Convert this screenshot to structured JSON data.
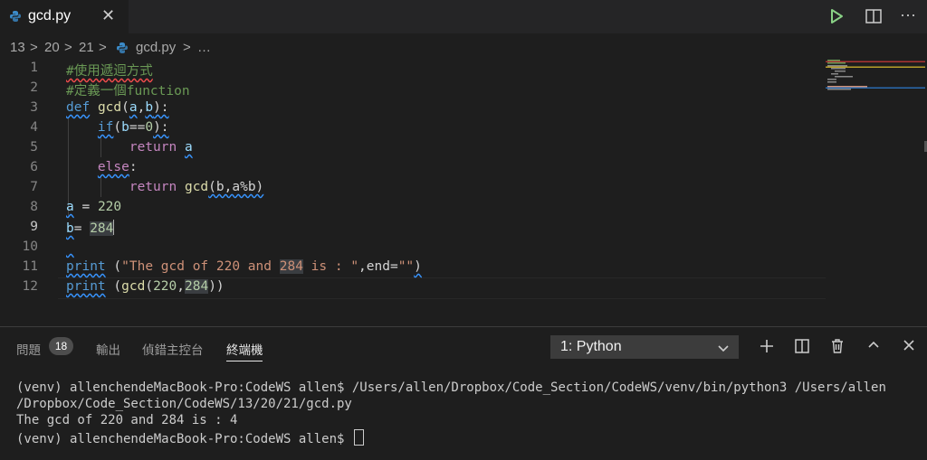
{
  "tab": {
    "filename": "gcd.py"
  },
  "breadcrumb": {
    "p1": "13",
    "p2": "20",
    "p3": "21",
    "file": "gcd.py",
    "more": "…",
    "sep": ">"
  },
  "editor": {
    "line_numbers": [
      "1",
      "2",
      "3",
      "4",
      "5",
      "6",
      "7",
      "8",
      "9",
      "10",
      "11",
      "12"
    ],
    "lines": {
      "l1": "#使用遞迴方式",
      "l2": "#定義一個function",
      "l3_kw": "def",
      "l3_fn": "gcd",
      "l3_rest1": "(",
      "l3_a": "a",
      "l3_comma": ",",
      "l3_b": "b",
      "l3_rest2": "):",
      "l4_kw": "if",
      "l4_p": "(",
      "l4_b": "b",
      "l4_eq": "==",
      "l4_num": "0",
      "l4_end": "):",
      "l5_kw": "return",
      "l5_a": "a",
      "l6_kw": "else",
      "l6_colon": ":",
      "l7_kw": "return",
      "l7_fn": "gcd",
      "l7_rest": "(b,a%b)",
      "l8_a": "a",
      "l8_eq": " = ",
      "l8_num": "220",
      "l9_b": "b",
      "l9_eq": "= ",
      "l9_num": "284",
      "l11_fn": "print",
      "l11_p": " (",
      "l11_str": "\"The gcd of 220 and ",
      "l11_hl": "284",
      "l11_str2": " is : \"",
      "l11_end": ",end=",
      "l11_str3": "\"\"",
      "l11_close": ")",
      "l12_fn": "print",
      "l12_p": " (",
      "l12_fn2": "gcd",
      "l12_args1": "(",
      "l12_n1": "220",
      "l12_c": ",",
      "l12_n2": "284",
      "l12_close": "))"
    }
  },
  "panel": {
    "tabs": {
      "problems": "問題",
      "problems_count": "18",
      "output": "輸出",
      "debug": "偵錯主控台",
      "terminal": "終端機"
    },
    "terminal_select": "1: Python",
    "terminal_lines": [
      "(venv) allenchendeMacBook-Pro:CodeWS allen$ /Users/allen/Dropbox/Code_Section/CodeWS/venv/bin/python3 /Users/allen",
      "/Dropbox/Code_Section/CodeWS/13/20/21/gcd.py",
      "The gcd of 220 and 284 is : 4",
      "(venv) allenchendeMacBook-Pro:CodeWS allen$ "
    ]
  },
  "icons": {
    "python": "python-icon",
    "close": "close-icon",
    "run": "run-icon",
    "split": "split-editor-icon",
    "more": "more-icon",
    "plus": "new-terminal-icon",
    "split_term": "split-terminal-icon",
    "trash": "trash-icon",
    "up": "chevron-up-icon",
    "close_panel": "close-icon",
    "chevron": "chevron-down-icon"
  },
  "colors": {
    "run": "#89d185",
    "keyword": "#569cd6",
    "function": "#dcdcaa",
    "number": "#b5cea8",
    "string": "#ce9178",
    "comment": "#6a9955"
  }
}
